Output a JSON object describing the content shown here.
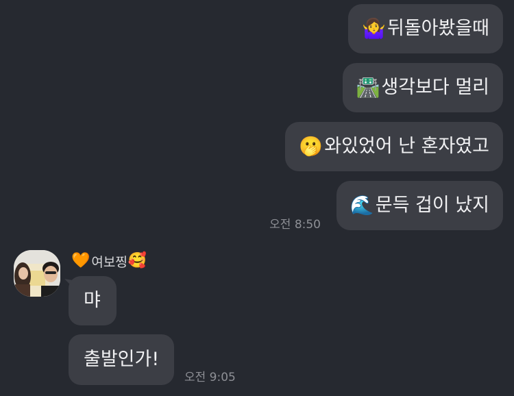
{
  "outgoing": [
    {
      "emoji": "🤷‍♀️",
      "emoji_name": "woman-shrugging-icon",
      "text": "뒤돌아봤을때"
    },
    {
      "emoji": "🛣️",
      "emoji_name": "motorway-icon",
      "text": "생각보다 멀리"
    },
    {
      "emoji": "🫢",
      "emoji_name": "hand-over-mouth-face-icon",
      "text": "와있었어 난 혼자였고"
    },
    {
      "emoji": "🌊",
      "emoji_name": "water-wave-icon",
      "text": "문득 겁이 났지"
    }
  ],
  "outgoing_time": "오전 8:50",
  "sender": {
    "prefix_emoji": "🧡",
    "prefix_emoji_name": "orange-heart-icon",
    "name": "여보찡",
    "suffix_emoji": "🥰",
    "suffix_emoji_name": "smiling-face-with-hearts-icon"
  },
  "incoming": [
    {
      "text": "먀"
    },
    {
      "text": "출발인가!"
    }
  ],
  "incoming_time": "오전 9:05",
  "colors": {
    "background": "#262930",
    "bubble": "#3c3e45",
    "text": "#f1f1f3",
    "timestamp": "#8e9096"
  }
}
